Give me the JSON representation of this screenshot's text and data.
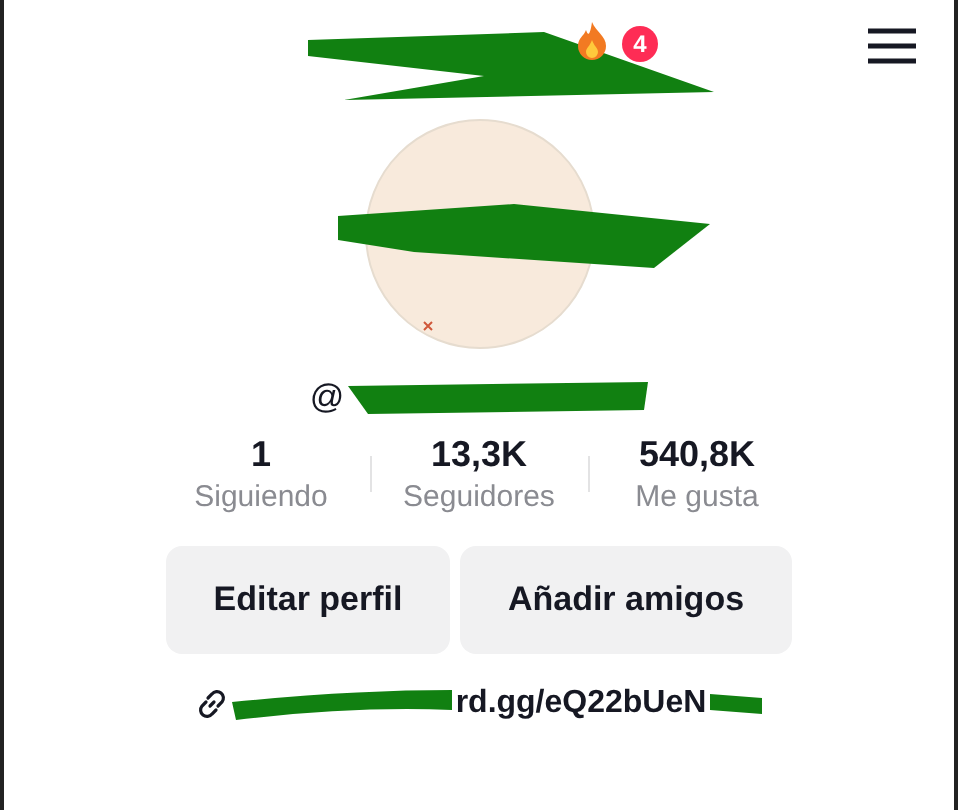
{
  "header": {
    "badge": "4"
  },
  "profile": {
    "handle_prefix": "@"
  },
  "stats": [
    {
      "value": "1",
      "label": "Siguiendo"
    },
    {
      "value": "13,3K",
      "label": "Seguidores"
    },
    {
      "value": "540,8K",
      "label": "Me gusta"
    }
  ],
  "buttons": [
    "Editar perfil",
    "Añadir amigos"
  ],
  "link": "rd.gg/eQ22bUeN"
}
